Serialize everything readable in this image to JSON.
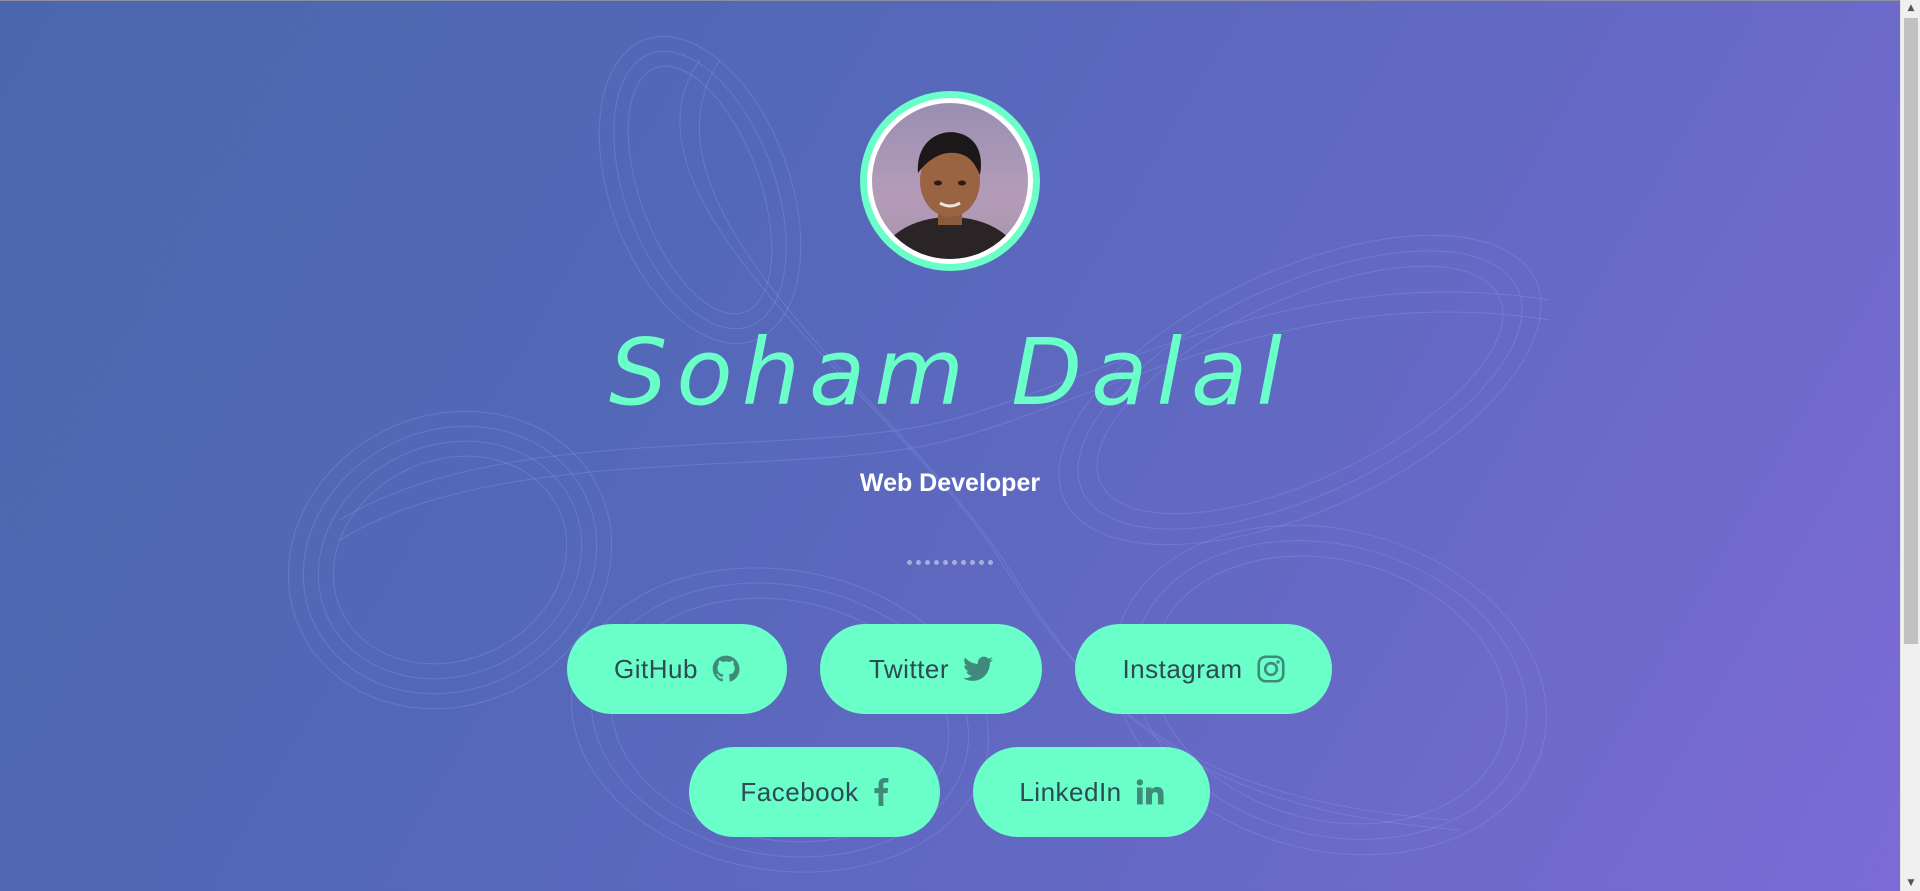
{
  "profile": {
    "name": "Soham Dalal",
    "role": "Web Developer"
  },
  "links": {
    "github": {
      "label": "GitHub",
      "icon": "github-icon"
    },
    "twitter": {
      "label": "Twitter",
      "icon": "twitter-icon"
    },
    "instagram": {
      "label": "Instagram",
      "icon": "instagram-icon"
    },
    "facebook": {
      "label": "Facebook",
      "icon": "facebook-icon"
    },
    "linkedin": {
      "label": "LinkedIn",
      "icon": "linkedin-icon"
    }
  },
  "colors": {
    "accent": "#6afec8",
    "button_text": "#2d4a55",
    "background_start": "#4a67ad",
    "background_end": "#7d6bd6"
  }
}
